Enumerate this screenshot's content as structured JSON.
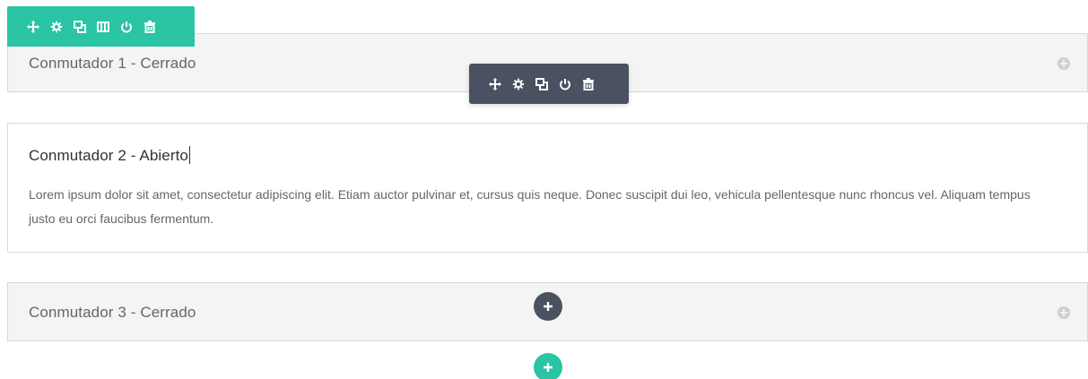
{
  "row_toolbar": {
    "buttons": [
      {
        "icon": "move-icon"
      },
      {
        "icon": "gear-icon"
      },
      {
        "icon": "duplicate-icon"
      },
      {
        "icon": "columns-icon"
      },
      {
        "icon": "power-icon"
      },
      {
        "icon": "trash-icon"
      }
    ],
    "color": "#2bc4a5"
  },
  "module_toolbar": {
    "buttons": [
      {
        "icon": "move-icon"
      },
      {
        "icon": "gear-icon"
      },
      {
        "icon": "duplicate-icon"
      },
      {
        "icon": "power-icon"
      },
      {
        "icon": "trash-icon"
      }
    ],
    "color": "#4a5160"
  },
  "toggles": [
    {
      "title": "Conmutador 1 - Cerrado",
      "state": "closed"
    },
    {
      "title": "Conmutador 2 - Abierto",
      "state": "open",
      "body": "Lorem ipsum dolor sit amet, consectetur adipiscing elit. Etiam auctor pulvinar et, cursus quis neque. Donec suscipit dui leo, vehicula pellentesque nunc rhoncus vel. Aliquam tempus justo eu orci faucibus fermentum."
    },
    {
      "title": "Conmutador 3 - Cerrado",
      "state": "closed"
    }
  ],
  "add_module_button": {
    "icon": "plus-icon",
    "color": "#4a5160"
  },
  "add_row_button": {
    "icon": "plus-icon",
    "color": "#2bc4a5"
  }
}
